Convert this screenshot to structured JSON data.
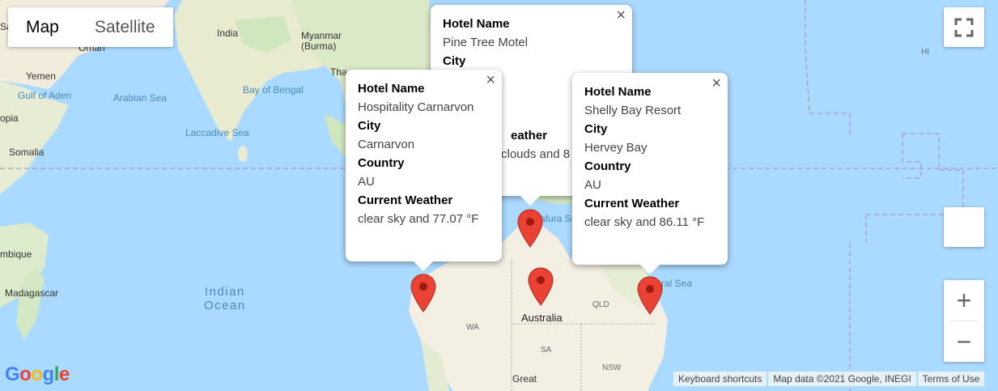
{
  "map_type": {
    "map_label": "Map",
    "satellite_label": "Satellite"
  },
  "labels": {
    "countries": {
      "oman": "Oman",
      "india": "India",
      "myanmar": "Myanmar\n(Burma)",
      "yemen": "Yemen",
      "ethiopia": "opia",
      "somalia": "Somalia",
      "mozambique": "mbique",
      "madagascar": "Madagascar",
      "australia": "Australia",
      "hi": "HI",
      "sa_partial": "Sa",
      "th_partial": "Tha"
    },
    "water": {
      "gulf_aden": "Gulf of Aden",
      "arabian_sea": "Arabian Sea",
      "bay_bengal": "Bay of Bengal",
      "laccadive": "Laccadive Sea",
      "arafura": "afura Se",
      "coral": "ral Sea",
      "indian_ocean": "Indian\nOcean"
    },
    "states": {
      "wa": "WA",
      "sa": "SA",
      "qld": "QLD",
      "nsw": "NSW",
      "great": "Great"
    }
  },
  "info_windows": [
    {
      "hotel_label": "Hotel Name",
      "hotel": "Pine Tree Motel",
      "city_label": "City",
      "city": "",
      "weather_label": "Current Weather",
      "weather_label_partial": "eather",
      "weather_partial": "clouds and 8"
    },
    {
      "hotel_label": "Hotel Name",
      "hotel": "Hospitality Carnarvon",
      "city_label": "City",
      "city": "Carnarvon",
      "country_label": "Country",
      "country": "AU",
      "weather_label": "Current Weather",
      "weather": "clear sky and 77.07 °F"
    },
    {
      "hotel_label": "Hotel Name",
      "hotel": "Shelly Bay Resort",
      "city_label": "City",
      "city": "Hervey Bay",
      "country_label": "Country",
      "country": "AU",
      "weather_label": "Current Weather",
      "weather": "clear sky and 86.11 °F"
    }
  ],
  "close_glyph": "×",
  "zoom": {
    "in": "+",
    "out": "−"
  },
  "google_logo": "Google",
  "footer": {
    "shortcuts": "Keyboard shortcuts",
    "mapdata": "Map data ©2021 Google, INEGI",
    "terms": "Terms of Use"
  },
  "colors": {
    "water": "#aadaff",
    "land": "#f3efe3",
    "green": "#cde8c0",
    "marker": "#ea4335",
    "marker_dot": "#9e1a0f"
  }
}
